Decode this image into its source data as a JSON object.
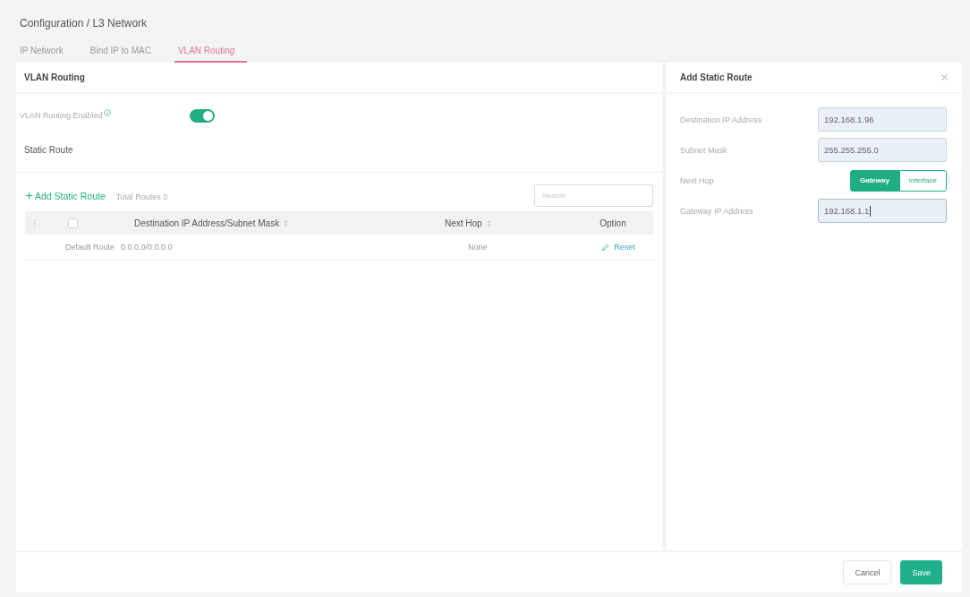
{
  "breadcrumb": "Configuration / L3 Network",
  "tabs": [
    {
      "label": "IP Network",
      "selected": false
    },
    {
      "label": "Bind IP to MAC",
      "selected": false
    },
    {
      "label": "VLAN Routing",
      "selected": true
    }
  ],
  "panel": {
    "title": "VLAN Routing",
    "toggle": {
      "label": "VLAN Routing Enabled",
      "on": true
    },
    "section_title": "Static Route",
    "add_button": "Add Static Route",
    "total": "Total Routes 0",
    "search": {
      "placeholder": "Search"
    },
    "table": {
      "header_checkbox": {
        "checked": false
      },
      "columns": [
        {
          "label": "Destination IP Address/Subnet Mask",
          "sortable": true
        },
        {
          "label": "Next Hop",
          "sortable": true
        },
        {
          "label": "Option",
          "sortable": false
        }
      ],
      "rows": [
        {
          "name": "Default Route",
          "destination": "0.0.0.0/0.0.0.0",
          "next_hop": "None",
          "action": "Reset"
        }
      ]
    }
  },
  "drawer": {
    "title": "Add Static Route",
    "fields": [
      {
        "kind": "input",
        "label": "Destination IP Address",
        "value": "192.168.1.96",
        "focused": false
      },
      {
        "kind": "input",
        "label": "Subnet Mask",
        "value": "255.255.255.0",
        "focused": false
      },
      {
        "kind": "segmented",
        "label": "Next Hop",
        "options": [
          {
            "label": "Gateway",
            "selected": true
          },
          {
            "label": "Interface",
            "selected": false
          }
        ]
      },
      {
        "kind": "input",
        "label": "Gateway IP Address",
        "value": "192.168.1.1",
        "focused": true
      }
    ]
  },
  "footer": {
    "buttons": [
      {
        "label": "Cancel",
        "kind": "secondary"
      },
      {
        "label": "Save",
        "kind": "primary"
      }
    ]
  }
}
